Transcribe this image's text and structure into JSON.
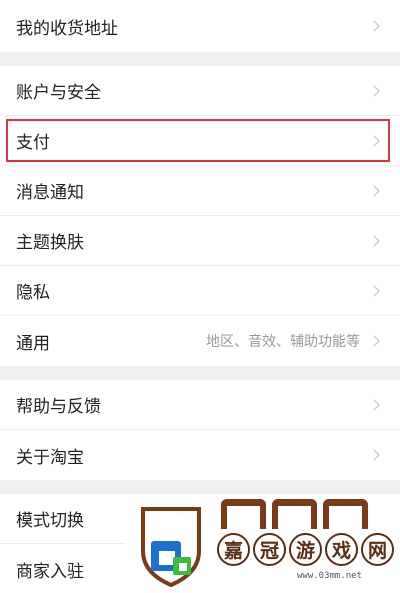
{
  "settings": {
    "address": "我的收货地址",
    "account_security": "账户与安全",
    "payment": "支付",
    "notifications": "消息通知",
    "theme": "主题换肤",
    "privacy": "隐私",
    "general": "通用",
    "general_detail": "地区、音效、辅助功能等",
    "help_feedback": "帮助与反馈",
    "about": "关于淘宝",
    "mode_switch": "模式切换",
    "merchant_entry": "商家入驻"
  },
  "watermark": {
    "chars": [
      "嘉",
      "冠",
      "游",
      "戏",
      "网"
    ],
    "url": "www.03mm.net"
  },
  "colors": {
    "highlight": "#e0343b",
    "watermark_brown": "#5a2e14",
    "watermark_blue": "#1f6fd1",
    "watermark_green": "#3dbb3d"
  }
}
